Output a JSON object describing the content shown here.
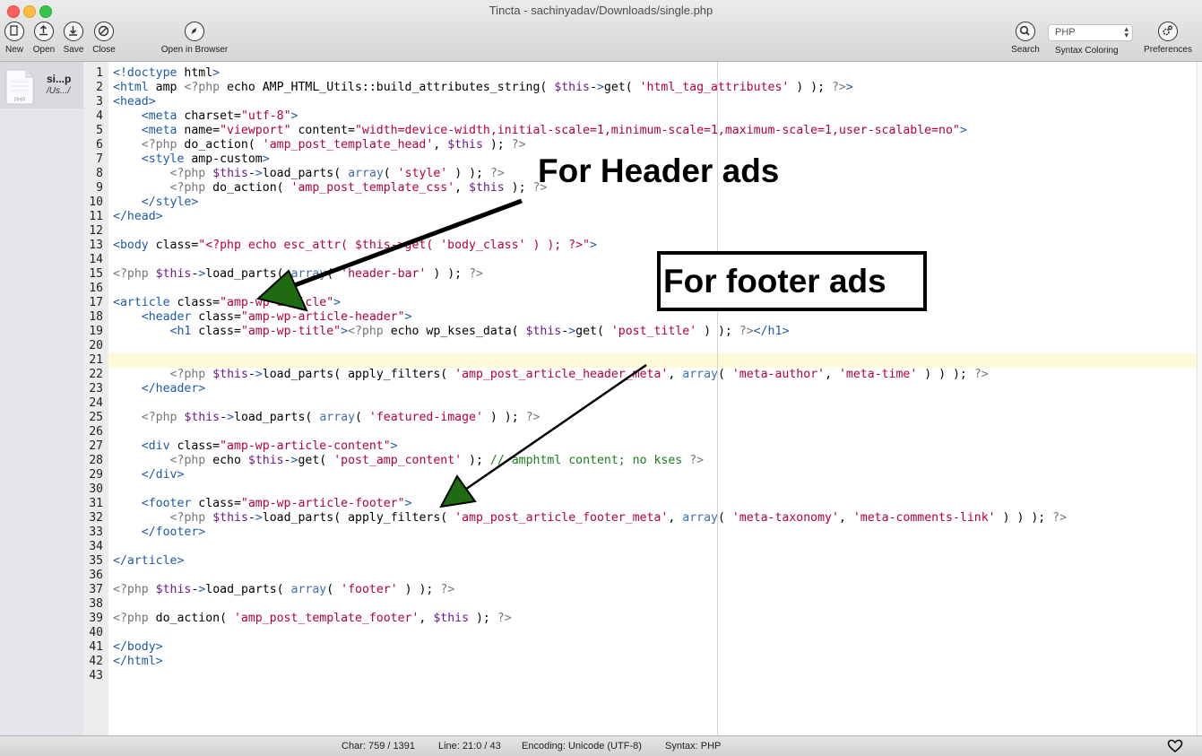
{
  "window": {
    "title": "Tincta - sachinyadav/Downloads/single.php"
  },
  "toolbar": {
    "new_label": "New",
    "open_label": "Open",
    "save_label": "Save",
    "close_label": "Close",
    "open_in_browser_label": "Open in Browser",
    "search_label": "Search",
    "syntax_value": "PHP",
    "syntax_label": "Syntax Coloring",
    "preferences_label": "Preferences"
  },
  "sidebar": {
    "file": {
      "name": "si...p",
      "path": "/Us.../",
      "icon_label": "PHP"
    }
  },
  "editor": {
    "current_line": 21,
    "lines": [
      "<!doctype html>",
      "<html amp <?php echo AMP_HTML_Utils::build_attributes_string( $this->get( 'html_tag_attributes' ) ); ?>>",
      "<head>",
      "    <meta charset=\"utf-8\">",
      "    <meta name=\"viewport\" content=\"width=device-width,initial-scale=1,minimum-scale=1,maximum-scale=1,user-scalable=no\">",
      "    <?php do_action( 'amp_post_template_head', $this ); ?>",
      "    <style amp-custom>",
      "        <?php $this->load_parts( array( 'style' ) ); ?>",
      "        <?php do_action( 'amp_post_template_css', $this ); ?>",
      "    </style>",
      "</head>",
      "",
      "<body class=\"<?php echo esc_attr( $this->get( 'body_class' ) ); ?>\">",
      "",
      "<?php $this->load_parts( array( 'header-bar' ) ); ?>",
      "",
      "<article class=\"amp-wp-article\">",
      "    <header class=\"amp-wp-article-header\">",
      "        <h1 class=\"amp-wp-title\"><?php echo wp_kses_data( $this->get( 'post_title' ) ); ?></h1>",
      "",
      "",
      "        <?php $this->load_parts( apply_filters( 'amp_post_article_header_meta', array( 'meta-author', 'meta-time' ) ) ); ?>",
      "    </header>",
      "",
      "    <?php $this->load_parts( array( 'featured-image' ) ); ?>",
      "",
      "    <div class=\"amp-wp-article-content\">",
      "        <?php echo $this->get( 'post_amp_content' ); // amphtml content; no kses ?>",
      "    </div>",
      "",
      "    <footer class=\"amp-wp-article-footer\">",
      "        <?php $this->load_parts( apply_filters( 'amp_post_article_footer_meta', array( 'meta-taxonomy', 'meta-comments-link' ) ) ); ?>",
      "    </footer>",
      "",
      "</article>",
      "",
      "<?php $this->load_parts( array( 'footer' ) ); ?>",
      "",
      "<?php do_action( 'amp_post_template_footer', $this ); ?>",
      "",
      "</body>",
      "</html>",
      ""
    ]
  },
  "annotations": {
    "header_ads": "For Header ads",
    "footer_ads": "For footer ads",
    "arrow_color": "#1e6b12"
  },
  "status": {
    "char": "Char: 759 / 1391",
    "line": "Line: 21:0 / 43",
    "encoding": "Encoding: Unicode (UTF-8)",
    "syntax": "Syntax: PHP"
  }
}
